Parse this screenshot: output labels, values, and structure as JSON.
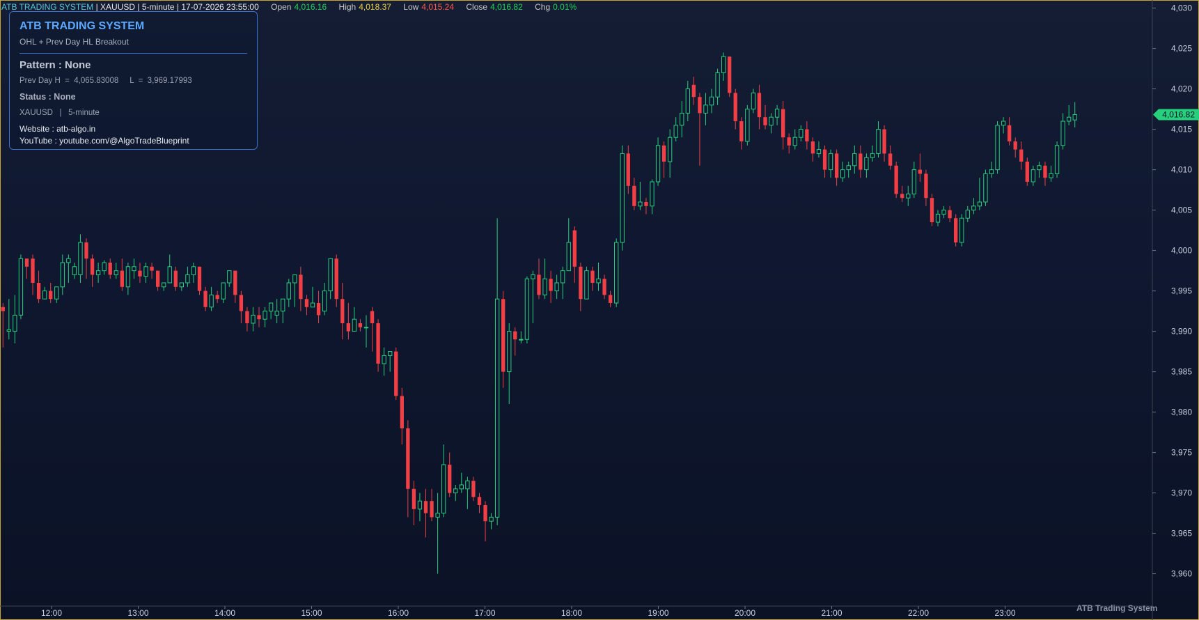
{
  "header": {
    "title": "ATB TRADING SYSTEM",
    "symbol": "XAUUSD",
    "interval": "5-minute",
    "datetime": "17-07-2026 23:55:00",
    "open_label": "Open",
    "open": "4,016.16",
    "high_label": "High",
    "high": "4,018.37",
    "low_label": "Low",
    "low": "4,015.24",
    "close_label": "Close",
    "close": "4,016.82",
    "chg_label": "Chg",
    "chg": "0.01%"
  },
  "infobox": {
    "title": "ATB TRADING SYSTEM",
    "subtitle": "OHL + Prev Day HL Breakout",
    "pattern": "Pattern : None",
    "prev_day": "Prev Day H  =  4,065.83008     L  =  3,969.17993",
    "status": "Status : None",
    "symbol_interval": "XAUUSD   |   5-minute",
    "website": "Website : atb-algo.in",
    "youtube": "YouTube : youtube.com/@AlgoTradeBlueprint"
  },
  "watermark": "ATB Trading System",
  "colors": {
    "up": "#26d07c",
    "down": "#f23f45",
    "price_badge": "#26d07c",
    "axis_text": "#c9d1e0",
    "border": "#c8a42a"
  },
  "chart_data": {
    "type": "candlestick",
    "ylim": [
      3956,
      4031
    ],
    "yticks": [
      3960,
      3965,
      3970,
      3975,
      3980,
      3985,
      3990,
      3995,
      4000,
      4005,
      4010,
      4015,
      4020,
      4025,
      4030
    ],
    "ytick_labels": [
      "3,960",
      "3,965",
      "3,970",
      "3,975",
      "3,980",
      "3,985",
      "3,990",
      "3,995",
      "4,000",
      "4,005",
      "4,010",
      "4,015",
      "4,020",
      "4,025",
      "4,030"
    ],
    "xticks": [
      "12:00",
      "13:00",
      "14:00",
      "15:00",
      "16:00",
      "17:00",
      "18:00",
      "19:00",
      "20:00",
      "21:00",
      "22:00",
      "23:00"
    ],
    "last_price": "4,016.82",
    "last_value": 4016.82,
    "candles": [
      [
        3993.0,
        3992.5,
        3993.5,
        3988.0
      ],
      [
        3990.0,
        3990.2,
        3994.0,
        3989.0
      ],
      [
        3990.0,
        3992.0,
        3994.5,
        3988.5
      ],
      [
        3992.0,
        3999.0,
        3999.5,
        3991.5
      ],
      [
        3999.0,
        3998.0,
        3999.0,
        3996.5
      ],
      [
        3999.0,
        3996.0,
        3999.5,
        3994.5
      ],
      [
        3996.0,
        3994.0,
        3997.5,
        3993.5
      ],
      [
        3994.0,
        3995.0,
        3995.5,
        3994.0
      ],
      [
        3995.0,
        3994.0,
        3996.0,
        3993.5
      ],
      [
        3994.0,
        3995.5,
        3995.5,
        3993.5
      ],
      [
        3995.5,
        3998.5,
        3999.5,
        3994.5
      ],
      [
        3998.5,
        3999.0,
        3999.5,
        3996.0
      ],
      [
        3997.0,
        3998.0,
        3998.5,
        3996.5
      ],
      [
        3997.0,
        4001.0,
        4002.0,
        3996.0
      ],
      [
        4001.0,
        3999.0,
        4001.5,
        3996.5
      ],
      [
        3999.0,
        3997.0,
        3999.5,
        3995.5
      ],
      [
        3997.0,
        3997.5,
        3998.5,
        3996.0
      ],
      [
        3997.5,
        3998.5,
        3998.8,
        3997.0
      ],
      [
        3998.5,
        3997.0,
        3999.0,
        3996.5
      ],
      [
        3997.0,
        3997.5,
        3998.5,
        3996.5
      ],
      [
        3997.5,
        3995.5,
        3999.0,
        3995.0
      ],
      [
        3995.5,
        3998.0,
        3998.5,
        3994.5
      ],
      [
        3997.5,
        3998.0,
        3999.0,
        3996.5
      ],
      [
        3997.5,
        3996.8,
        3998.5,
        3996.0
      ],
      [
        3996.8,
        3998.0,
        3998.5,
        3996.0
      ],
      [
        3998.0,
        3997.5,
        3998.5,
        3996.5
      ],
      [
        3997.5,
        3995.5,
        3997.5,
        3995.0
      ],
      [
        3995.5,
        3996.0,
        3996.0,
        3995.0
      ],
      [
        3996.0,
        3998.0,
        3999.5,
        3996.0
      ],
      [
        3997.5,
        3995.5,
        3998.0,
        3995.0
      ],
      [
        3995.5,
        3996.0,
        3996.0,
        3995.0
      ],
      [
        3996.0,
        3997.0,
        3998.0,
        3995.5
      ],
      [
        3997.0,
        3998.0,
        3998.5,
        3996.0
      ],
      [
        3998.0,
        3995.0,
        3998.0,
        3994.5
      ],
      [
        3995.0,
        3993.0,
        3995.5,
        3992.5
      ],
      [
        3993.0,
        3994.5,
        3995.5,
        3992.5
      ],
      [
        3994.5,
        3994.0,
        3995.0,
        3993.5
      ],
      [
        3994.0,
        3996.0,
        3996.0,
        3993.5
      ],
      [
        3996.0,
        3997.5,
        3997.5,
        3995.5
      ],
      [
        3997.5,
        3994.5,
        3997.5,
        3993.5
      ],
      [
        3994.5,
        3992.5,
        3995.0,
        3991.0
      ],
      [
        3992.5,
        3991.0,
        3993.0,
        3990.0
      ],
      [
        3991.0,
        3992.0,
        3993.0,
        3990.0
      ],
      [
        3992.0,
        3991.5,
        3993.0,
        3990.5
      ],
      [
        3991.5,
        3992.5,
        3993.0,
        3990.5
      ],
      [
        3992.5,
        3993.5,
        3993.5,
        3991.5
      ],
      [
        3992.0,
        3992.5,
        3994.0,
        3991.0
      ],
      [
        3992.5,
        3994.0,
        3994.0,
        3991.0
      ],
      [
        3994.0,
        3996.0,
        3996.5,
        3993.0
      ],
      [
        3996.0,
        3997.0,
        3997.0,
        3993.0
      ],
      [
        3997.0,
        3994.0,
        3998.0,
        3992.5
      ],
      [
        3994.0,
        3993.0,
        3994.5,
        3992.0
      ],
      [
        3993.0,
        3993.5,
        3995.5,
        3993.0
      ],
      [
        3993.5,
        3992.0,
        3995.0,
        3991.0
      ],
      [
        3992.5,
        3995.0,
        3996.0,
        3992.0
      ],
      [
        3995.0,
        3999.0,
        3999.0,
        3994.0
      ],
      [
        3999.0,
        3994.0,
        3999.5,
        3993.0
      ],
      [
        3994.0,
        3991.0,
        3996.0,
        3989.0
      ],
      [
        3991.0,
        3990.0,
        3993.5,
        3989.0
      ],
      [
        3990.0,
        3991.5,
        3993.0,
        3990.0
      ],
      [
        3991.0,
        3990.5,
        3991.5,
        3990.0
      ],
      [
        3990.5,
        3990.5,
        3992.0,
        3988.0
      ],
      [
        3992.5,
        3991.0,
        3993.0,
        3987.5
      ],
      [
        3991.0,
        3986.0,
        3991.5,
        3985.0
      ],
      [
        3986.0,
        3987.0,
        3988.0,
        3984.5
      ],
      [
        3987.0,
        3987.5,
        3987.5,
        3985.0
      ],
      [
        3987.5,
        3982.0,
        3988.0,
        3981.5
      ],
      [
        3982.0,
        3978.0,
        3983.0,
        3976.0
      ],
      [
        3978.0,
        3970.5,
        3979.0,
        3967.0
      ],
      [
        3970.5,
        3968.0,
        3971.5,
        3966.0
      ],
      [
        3968.0,
        3969.0,
        3970.0,
        3966.5
      ],
      [
        3969.0,
        3967.5,
        3970.5,
        3964.5
      ],
      [
        3969.0,
        3967.0,
        3970.5,
        3966.5
      ],
      [
        3967.0,
        3967.5,
        3970.0,
        3960.0
      ],
      [
        3967.5,
        3973.5,
        3976.0,
        3967.0
      ],
      [
        3973.5,
        3970.0,
        3975.0,
        3969.5
      ],
      [
        3970.0,
        3970.5,
        3971.0,
        3969.0
      ],
      [
        3970.5,
        3971.0,
        3972.5,
        3970.0
      ],
      [
        3970.5,
        3971.5,
        3972.0,
        3968.0
      ],
      [
        3971.5,
        3969.5,
        3972.0,
        3969.0
      ],
      [
        3969.5,
        3968.5,
        3970.0,
        3967.5
      ],
      [
        3968.5,
        3966.5,
        3969.0,
        3964.0
      ],
      [
        3966.5,
        3967.0,
        3967.5,
        3965.5
      ],
      [
        3967.0,
        3994.0,
        4004.0,
        3966.0
      ],
      [
        3994.0,
        3985.0,
        3995.0,
        3983.0
      ],
      [
        3985.0,
        3990.0,
        3991.0,
        3981.0
      ],
      [
        3990.0,
        3989.0,
        3990.5,
        3987.0
      ],
      [
        3989.0,
        3989.0,
        3990.0,
        3988.5
      ],
      [
        3989.0,
        3996.5,
        3996.8,
        3988.5
      ],
      [
        3996.5,
        3997.0,
        3997.5,
        3991.0
      ],
      [
        3997.0,
        3994.5,
        3999.0,
        3994.0
      ],
      [
        3994.5,
        3996.5,
        3999.0,
        3994.0
      ],
      [
        3996.5,
        3995.0,
        3997.5,
        3993.5
      ],
      [
        3995.0,
        3996.0,
        3997.0,
        3994.0
      ],
      [
        3996.0,
        3997.5,
        3998.0,
        3994.0
      ],
      [
        3997.5,
        4001.0,
        4004.0,
        3997.5
      ],
      [
        4002.5,
        3998.0,
        4003.0,
        3996.0
      ],
      [
        3998.0,
        3994.0,
        3998.5,
        3992.5
      ],
      [
        3994.0,
        3997.5,
        3998.0,
        3994.0
      ],
      [
        3997.5,
        3996.0,
        3998.0,
        3995.0
      ],
      [
        3996.0,
        3996.5,
        3998.5,
        3995.0
      ],
      [
        3996.5,
        3994.5,
        3997.0,
        3994.0
      ],
      [
        3994.5,
        3993.5,
        3995.0,
        3993.0
      ],
      [
        3993.5,
        4001.0,
        4001.5,
        3993.0
      ],
      [
        4001.0,
        4012.0,
        4013.0,
        4000.0
      ],
      [
        4012.0,
        4008.0,
        4013.0,
        4007.0
      ],
      [
        4008.0,
        4005.5,
        4009.0,
        4005.0
      ],
      [
        4005.5,
        4006.0,
        4008.5,
        4005.0
      ],
      [
        4006.0,
        4005.5,
        4006.5,
        4004.5
      ],
      [
        4005.5,
        4008.5,
        4008.8,
        4004.5
      ],
      [
        4008.5,
        4013.0,
        4014.0,
        4008.0
      ],
      [
        4013.0,
        4011.0,
        4013.5,
        4009.0
      ],
      [
        4011.0,
        4014.0,
        4015.0,
        4009.0
      ],
      [
        4014.0,
        4015.5,
        4016.5,
        4013.5
      ],
      [
        4015.5,
        4017.0,
        4018.5,
        4014.0
      ],
      [
        4017.0,
        4020.0,
        4021.0,
        4016.0
      ],
      [
        4020.5,
        4019.0,
        4021.5,
        4018.0
      ],
      [
        4019.0,
        4017.0,
        4019.5,
        4010.5
      ],
      [
        4017.0,
        4018.0,
        4019.5,
        4015.5
      ],
      [
        4018.0,
        4019.0,
        4020.0,
        4017.0
      ],
      [
        4019.0,
        4022.0,
        4022.5,
        4018.0
      ],
      [
        4022.0,
        4024.0,
        4024.5,
        4021.0
      ],
      [
        4024.0,
        4019.5,
        4024.0,
        4019.0
      ],
      [
        4019.5,
        4016.0,
        4020.0,
        4015.0
      ],
      [
        4016.0,
        4013.5,
        4016.5,
        4012.5
      ],
      [
        4013.5,
        4017.5,
        4018.0,
        4013.0
      ],
      [
        4017.5,
        4019.5,
        4020.0,
        4017.0
      ],
      [
        4019.5,
        4016.5,
        4020.5,
        4015.0
      ],
      [
        4016.5,
        4015.5,
        4018.0,
        4015.0
      ],
      [
        4015.5,
        4016.5,
        4017.0,
        4014.5
      ],
      [
        4016.5,
        4017.5,
        4018.0,
        4015.5
      ],
      [
        4017.5,
        4014.0,
        4018.5,
        4012.5
      ],
      [
        4014.0,
        4013.0,
        4014.5,
        4012.0
      ],
      [
        4013.0,
        4014.0,
        4015.0,
        4012.5
      ],
      [
        4014.0,
        4015.0,
        4015.5,
        4013.5
      ],
      [
        4015.0,
        4013.5,
        4016.0,
        4012.5
      ],
      [
        4013.5,
        4012.0,
        4014.0,
        4011.0
      ],
      [
        4012.0,
        4012.5,
        4013.5,
        4011.5
      ],
      [
        4012.5,
        4010.0,
        4013.0,
        4009.0
      ],
      [
        4010.0,
        4012.0,
        4012.5,
        4009.0
      ],
      [
        4012.0,
        4009.0,
        4012.5,
        4008.0
      ],
      [
        4009.0,
        4010.0,
        4011.0,
        4008.5
      ],
      [
        4010.0,
        4010.5,
        4011.0,
        4009.0
      ],
      [
        4010.5,
        4012.0,
        4013.0,
        4009.5
      ],
      [
        4012.0,
        4010.0,
        4013.0,
        4009.0
      ],
      [
        4010.0,
        4011.5,
        4012.0,
        4009.0
      ],
      [
        4011.5,
        4012.0,
        4013.0,
        4011.0
      ],
      [
        4012.0,
        4015.0,
        4016.0,
        4011.5
      ],
      [
        4015.0,
        4012.0,
        4015.5,
        4011.0
      ],
      [
        4012.0,
        4010.5,
        4013.0,
        4010.0
      ],
      [
        4010.5,
        4007.0,
        4011.0,
        4006.5
      ],
      [
        4007.0,
        4006.5,
        4008.0,
        4006.0
      ],
      [
        4006.5,
        4007.0,
        4008.0,
        4005.5
      ],
      [
        4007.0,
        4010.0,
        4011.0,
        4006.5
      ],
      [
        4010.0,
        4009.5,
        4012.0,
        4008.5
      ],
      [
        4009.5,
        4006.5,
        4010.0,
        4005.5
      ],
      [
        4006.5,
        4003.5,
        4007.0,
        4003.0
      ],
      [
        4003.5,
        4004.5,
        4005.0,
        4003.0
      ],
      [
        4004.5,
        4005.0,
        4005.5,
        4004.0
      ],
      [
        4005.0,
        4004.0,
        4005.5,
        4003.5
      ],
      [
        4004.0,
        4001.0,
        4004.5,
        4000.5
      ],
      [
        4001.0,
        4004.0,
        4004.5,
        4000.5
      ],
      [
        4004.0,
        4005.0,
        4005.5,
        4003.5
      ],
      [
        4005.0,
        4005.5,
        4006.5,
        4004.5
      ],
      [
        4005.5,
        4006.0,
        4009.0,
        4005.0
      ],
      [
        4006.0,
        4009.5,
        4010.0,
        4005.5
      ],
      [
        4009.5,
        4010.0,
        4011.0,
        4009.0
      ],
      [
        4010.0,
        4015.5,
        4016.0,
        4009.5
      ],
      [
        4015.5,
        4016.0,
        4016.5,
        4014.5
      ],
      [
        4015.5,
        4013.5,
        4016.5,
        4013.0
      ],
      [
        4013.5,
        4012.5,
        4014.0,
        4011.5
      ],
      [
        4012.5,
        4011.0,
        4013.5,
        4010.0
      ],
      [
        4011.0,
        4008.5,
        4011.5,
        4008.0
      ],
      [
        4008.5,
        4010.0,
        4010.5,
        4008.0
      ],
      [
        4010.0,
        4010.5,
        4011.0,
        4009.0
      ],
      [
        4010.5,
        4009.0,
        4011.0,
        4008.0
      ],
      [
        4009.0,
        4009.5,
        4010.5,
        4008.5
      ],
      [
        4009.5,
        4013.0,
        4013.5,
        4009.0
      ],
      [
        4013.0,
        4016.0,
        4017.0,
        4012.5
      ],
      [
        4016.0,
        4016.5,
        4018.0,
        4015.5
      ],
      [
        4016.16,
        4016.82,
        4018.37,
        4015.24
      ]
    ]
  }
}
